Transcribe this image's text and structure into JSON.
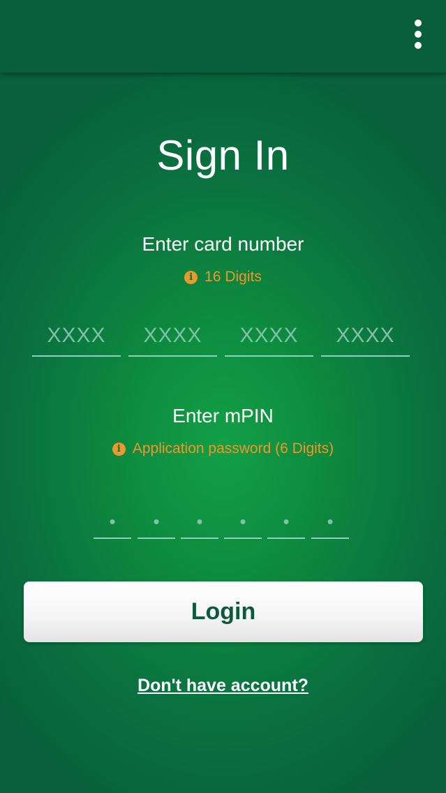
{
  "colors": {
    "appbar": "#075e3b",
    "background": "#0b7a3f",
    "hint": "#f0962a",
    "button_text": "#0c5a3e"
  },
  "appbar": {
    "menu_icon": "more-vertical-icon"
  },
  "title": "Sign In",
  "card": {
    "label": "Enter card number",
    "hint_icon": "info-icon",
    "hint": "16 Digits",
    "fields": [
      {
        "placeholder": "XXXX",
        "value": ""
      },
      {
        "placeholder": "XXXX",
        "value": ""
      },
      {
        "placeholder": "XXXX",
        "value": ""
      },
      {
        "placeholder": "XXXX",
        "value": ""
      }
    ]
  },
  "mpin": {
    "label": "Enter mPIN",
    "hint_icon": "info-icon",
    "hint": "Application password (6 Digits)",
    "fields": [
      {
        "placeholder": "•",
        "value": ""
      },
      {
        "placeholder": "•",
        "value": ""
      },
      {
        "placeholder": "•",
        "value": ""
      },
      {
        "placeholder": "•",
        "value": ""
      },
      {
        "placeholder": "•",
        "value": ""
      },
      {
        "placeholder": "•",
        "value": ""
      }
    ]
  },
  "login_label": "Login",
  "signup_link": "Don't have account?"
}
